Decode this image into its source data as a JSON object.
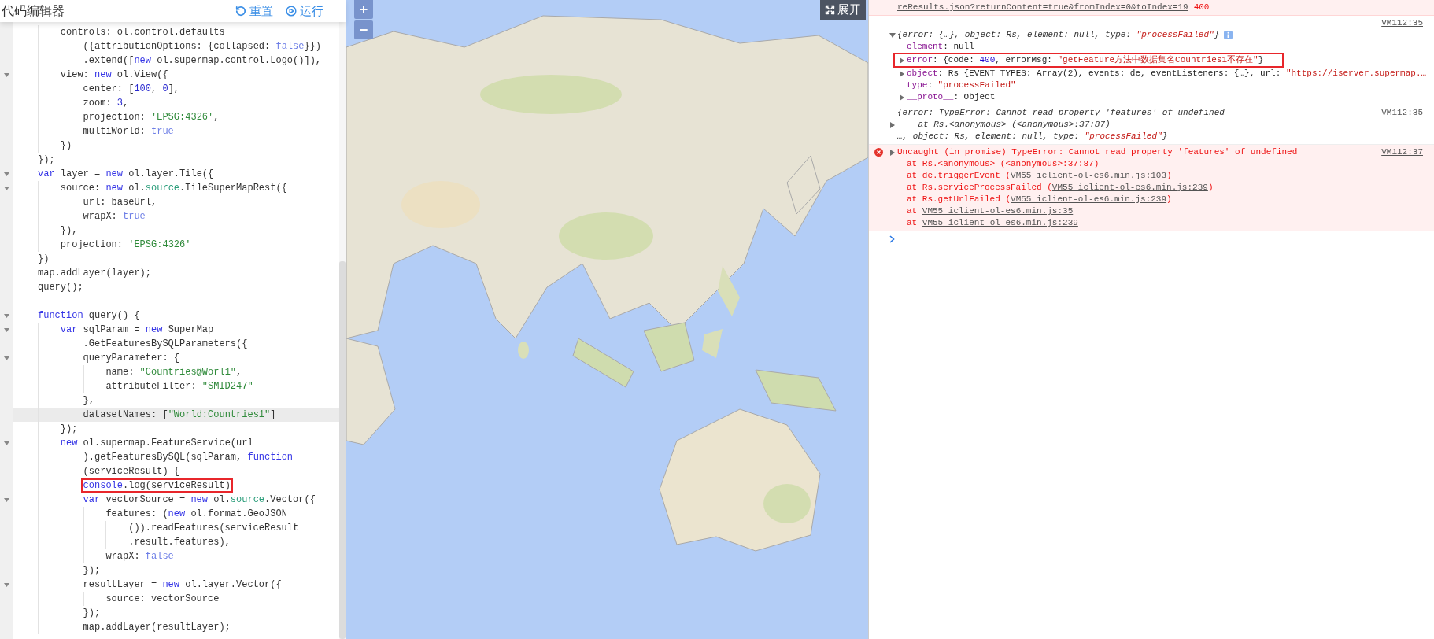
{
  "editor": {
    "title": "代码编辑器",
    "buttons": [
      {
        "label": "重置",
        "kind": "reset"
      },
      {
        "label": "运行",
        "kind": "run"
      }
    ],
    "lines": [
      {
        "segments": [
          {
            "text": "    controls: ol.control.defaults",
            "kind": "plain"
          }
        ]
      },
      {
        "segments": [
          {
            "text": "        ({attributionOptions: {collapsed: ",
            "kind": "plain"
          },
          {
            "text": "false",
            "kind": "atom"
          },
          {
            "text": "}})",
            "kind": "plain"
          }
        ]
      },
      {
        "segments": [
          {
            "text": "        .extend([",
            "kind": "plain"
          },
          {
            "text": "new",
            "kind": "keyword"
          },
          {
            "text": " ol.supermap.control.Logo()]),",
            "kind": "plain"
          }
        ]
      },
      {
        "segments": [
          {
            "text": "    view: ",
            "kind": "plain"
          },
          {
            "text": "new",
            "kind": "keyword"
          },
          {
            "text": " ol.View({",
            "kind": "plain"
          }
        ],
        "fold": true
      },
      {
        "segments": [
          {
            "text": "        center: [",
            "kind": "plain"
          },
          {
            "text": "100",
            "kind": "number"
          },
          {
            "text": ", ",
            "kind": "plain"
          },
          {
            "text": "0",
            "kind": "number"
          },
          {
            "text": "],",
            "kind": "plain"
          }
        ]
      },
      {
        "segments": [
          {
            "text": "        zoom: ",
            "kind": "plain"
          },
          {
            "text": "3",
            "kind": "number"
          },
          {
            "text": ",",
            "kind": "plain"
          }
        ]
      },
      {
        "segments": [
          {
            "text": "        projection: ",
            "kind": "plain"
          },
          {
            "text": "'EPSG:4326'",
            "kind": "string"
          },
          {
            "text": ",",
            "kind": "plain"
          }
        ]
      },
      {
        "segments": [
          {
            "text": "        multiWorld: ",
            "kind": "plain"
          },
          {
            "text": "true",
            "kind": "atom"
          }
        ]
      },
      {
        "segments": [
          {
            "text": "    })",
            "kind": "plain"
          }
        ]
      },
      {
        "segments": [
          {
            "text": "});",
            "kind": "plain"
          }
        ]
      },
      {
        "segments": [
          {
            "text": "var",
            "kind": "keyword"
          },
          {
            "text": " layer = ",
            "kind": "plain"
          },
          {
            "text": "new",
            "kind": "keyword"
          },
          {
            "text": " ol.layer.Tile({",
            "kind": "plain"
          }
        ],
        "fold": true
      },
      {
        "segments": [
          {
            "text": "    source: ",
            "kind": "plain"
          },
          {
            "text": "new",
            "kind": "keyword"
          },
          {
            "text": " ol.",
            "kind": "plain"
          },
          {
            "text": "source",
            "kind": "builtin"
          },
          {
            "text": ".TileSuperMapRest({",
            "kind": "plain"
          }
        ],
        "fold": true
      },
      {
        "segments": [
          {
            "text": "        url: baseUrl,",
            "kind": "plain"
          }
        ]
      },
      {
        "segments": [
          {
            "text": "        wrapX: ",
            "kind": "plain"
          },
          {
            "text": "true",
            "kind": "atom"
          }
        ]
      },
      {
        "segments": [
          {
            "text": "    }),",
            "kind": "plain"
          }
        ]
      },
      {
        "segments": [
          {
            "text": "    projection: ",
            "kind": "plain"
          },
          {
            "text": "'EPSG:4326'",
            "kind": "string"
          }
        ]
      },
      {
        "segments": [
          {
            "text": "})",
            "kind": "plain"
          }
        ]
      },
      {
        "segments": [
          {
            "text": "map.addLayer(layer);",
            "kind": "plain"
          }
        ]
      },
      {
        "segments": [
          {
            "text": "query();",
            "kind": "plain"
          }
        ]
      },
      {
        "blank": true
      },
      {
        "segments": [
          {
            "text": "function",
            "kind": "keyword"
          },
          {
            "text": " query() {",
            "kind": "plain"
          }
        ],
        "fold": true
      },
      {
        "segments": [
          {
            "text": "    var",
            "kind": "keyword"
          },
          {
            "text": " sqlParam = ",
            "kind": "plain"
          },
          {
            "text": "new",
            "kind": "keyword"
          },
          {
            "text": " SuperMap",
            "kind": "plain"
          }
        ],
        "fold": true
      },
      {
        "segments": [
          {
            "text": "        .GetFeaturesBySQLParameters({",
            "kind": "plain"
          }
        ]
      },
      {
        "segments": [
          {
            "text": "        queryParameter: {",
            "kind": "plain"
          }
        ],
        "fold": true
      },
      {
        "segments": [
          {
            "text": "            name: ",
            "kind": "plain"
          },
          {
            "text": "\"Countries@Worl1\"",
            "kind": "string"
          },
          {
            "text": ",",
            "kind": "plain"
          }
        ]
      },
      {
        "segments": [
          {
            "text": "            attributeFilter: ",
            "kind": "plain"
          },
          {
            "text": "\"SMID247\"",
            "kind": "string"
          }
        ]
      },
      {
        "segments": [
          {
            "text": "        },",
            "kind": "plain"
          }
        ]
      },
      {
        "segments": [
          {
            "text": "        datasetNames: [",
            "kind": "plain"
          },
          {
            "text": "\"World:Countries1\"",
            "kind": "string"
          },
          {
            "text": "]",
            "kind": "plain"
          }
        ],
        "active": true
      },
      {
        "segments": [
          {
            "text": "    });",
            "kind": "plain"
          }
        ]
      },
      {
        "segments": [
          {
            "text": "    new",
            "kind": "keyword"
          },
          {
            "text": " ol.supermap.FeatureService(url",
            "kind": "plain"
          }
        ],
        "fold": true
      },
      {
        "segments": [
          {
            "text": "        ).getFeaturesBySQL(sqlParam, ",
            "kind": "plain"
          },
          {
            "text": "function",
            "kind": "keyword"
          }
        ]
      },
      {
        "segments": [
          {
            "text": "        (serviceResult) {",
            "kind": "plain"
          }
        ]
      },
      {
        "segments": [
          {
            "text": "        console",
            "kind": "keyword"
          },
          {
            "text": ".log(serviceResult)",
            "kind": "plain"
          }
        ],
        "boxed": true
      },
      {
        "segments": [
          {
            "text": "        var",
            "kind": "keyword"
          },
          {
            "text": " vectorSource = ",
            "kind": "plain"
          },
          {
            "text": "new",
            "kind": "keyword"
          },
          {
            "text": " ol.",
            "kind": "plain"
          },
          {
            "text": "source",
            "kind": "builtin"
          },
          {
            "text": ".Vector({",
            "kind": "plain"
          }
        ],
        "fold": true
      },
      {
        "segments": [
          {
            "text": "            features: (",
            "kind": "plain"
          },
          {
            "text": "new",
            "kind": "keyword"
          },
          {
            "text": " ol.format.GeoJSON",
            "kind": "plain"
          }
        ]
      },
      {
        "segments": [
          {
            "text": "                ()).readFeatures(serviceResult",
            "kind": "plain"
          }
        ]
      },
      {
        "segments": [
          {
            "text": "                .result.features),",
            "kind": "plain"
          }
        ]
      },
      {
        "segments": [
          {
            "text": "            wrapX: ",
            "kind": "plain"
          },
          {
            "text": "false",
            "kind": "atom"
          }
        ]
      },
      {
        "segments": [
          {
            "text": "        });",
            "kind": "plain"
          }
        ]
      },
      {
        "segments": [
          {
            "text": "        resultLayer = ",
            "kind": "plain"
          },
          {
            "text": "new",
            "kind": "keyword"
          },
          {
            "text": " ol.layer.Vector({",
            "kind": "plain"
          }
        ],
        "fold": true
      },
      {
        "segments": [
          {
            "text": "            source: vectorSource",
            "kind": "plain"
          }
        ]
      },
      {
        "segments": [
          {
            "text": "        });",
            "kind": "plain"
          }
        ]
      },
      {
        "segments": [
          {
            "text": "        map.addLayer(resultLayer);",
            "kind": "plain"
          }
        ]
      }
    ]
  },
  "map": {
    "zoom_in": "+",
    "zoom_out": "−",
    "expand_button": "展开"
  },
  "console": {
    "entries": [
      {
        "kind": "error",
        "rows": [
          {
            "segments": [
              {
                "text": "reResults.json?returnContent=true&fromIndex=0&toIndex=19",
                "kind": "link"
              },
              {
                "text": "400",
                "kind": "status"
              }
            ]
          }
        ]
      },
      {
        "kind": "log",
        "source": "VM112:35",
        "source_above": true,
        "rows": [
          {
            "expanded": true,
            "info": true,
            "segments": [
              {
                "text": "{error: {…}, object: Rs, element: null, type: ",
                "kind": "italic"
              },
              {
                "text": "\"processFailed\"",
                "kind": "italic-string"
              },
              {
                "text": "}",
                "kind": "italic"
              }
            ],
            "children": [
              {
                "segments": [
                  {
                    "text": "element",
                    "kind": "key"
                  },
                  {
                    "text": ": null",
                    "kind": "plain"
                  }
                ]
              },
              {
                "expanded": false,
                "boxed": true,
                "segments": [
                  {
                    "text": "error",
                    "kind": "key"
                  },
                  {
                    "text": ": {code: ",
                    "kind": "plain"
                  },
                  {
                    "text": "400",
                    "kind": "number"
                  },
                  {
                    "text": ", errorMsg: ",
                    "kind": "plain"
                  },
                  {
                    "text": "\"getFeature方法中数据集名Countries1不存在\"",
                    "kind": "string"
                  },
                  {
                    "text": "}",
                    "kind": "plain"
                  }
                ]
              },
              {
                "expanded": false,
                "segments": [
                  {
                    "text": "object",
                    "kind": "key"
                  },
                  {
                    "text": ": Rs {EVENT_TYPES: Array(2), events: de, eventListeners: {…}, url: ",
                    "kind": "plain"
                  },
                  {
                    "text": "\"https://iserver.supermap.…",
                    "kind": "string"
                  }
                ]
              },
              {
                "segments": [
                  {
                    "text": "type",
                    "kind": "key"
                  },
                  {
                    "text": ": ",
                    "kind": "plain"
                  },
                  {
                    "text": "\"processFailed\"",
                    "kind": "string"
                  }
                ]
              },
              {
                "expanded": false,
                "segments": [
                  {
                    "text": "__proto__",
                    "kind": "key"
                  },
                  {
                    "text": ": Object",
                    "kind": "plain"
                  }
                ]
              }
            ]
          }
        ]
      },
      {
        "kind": "log",
        "source": "VM112:35",
        "rows": [
          {
            "segments": [
              {
                "text": "{error: TypeError: Cannot read property 'features' of undefined",
                "kind": "italic"
              }
            ]
          },
          {
            "expanded": false,
            "segments": [
              {
                "text": "    at Rs.<anonymous> (<anonymous>:37:87)",
                "kind": "italic"
              }
            ]
          },
          {
            "segments": [
              {
                "text": "…, object: Rs, element: null, type: ",
                "kind": "italic"
              },
              {
                "text": "\"processFailed\"",
                "kind": "italic-string"
              },
              {
                "text": "}",
                "kind": "italic"
              }
            ]
          }
        ]
      },
      {
        "kind": "error",
        "icon": true,
        "source": "VM112:37",
        "rows": [
          {
            "expanded": false,
            "segments": [
              {
                "text": "Uncaught (in promise) TypeError: Cannot read property 'features' of undefined",
                "kind": "error"
              }
            ],
            "children": [
              {
                "segments": [
                  {
                    "text": "at Rs.<anonymous> (<anonymous>:37:87)",
                    "kind": "error"
                  }
                ]
              },
              {
                "segments": [
                  {
                    "text": "at de.triggerEvent (",
                    "kind": "error"
                  },
                  {
                    "text": "VM55 iclient-ol-es6.min.js:103",
                    "kind": "link"
                  },
                  {
                    "text": ")",
                    "kind": "error"
                  }
                ]
              },
              {
                "segments": [
                  {
                    "text": "at Rs.serviceProcessFailed (",
                    "kind": "error"
                  },
                  {
                    "text": "VM55 iclient-ol-es6.min.js:239",
                    "kind": "link"
                  },
                  {
                    "text": ")",
                    "kind": "error"
                  }
                ]
              },
              {
                "segments": [
                  {
                    "text": "at Rs.getUrlFailed (",
                    "kind": "error"
                  },
                  {
                    "text": "VM55 iclient-ol-es6.min.js:239",
                    "kind": "link"
                  },
                  {
                    "text": ")",
                    "kind": "error"
                  }
                ]
              },
              {
                "segments": [
                  {
                    "text": "at ",
                    "kind": "error"
                  },
                  {
                    "text": "VM55 iclient-ol-es6.min.js:35",
                    "kind": "link"
                  }
                ]
              },
              {
                "segments": [
                  {
                    "text": "at ",
                    "kind": "error"
                  },
                  {
                    "text": "VM55 iclient-ol-es6.min.js:239",
                    "kind": "link"
                  }
                ]
              }
            ]
          }
        ]
      }
    ]
  }
}
